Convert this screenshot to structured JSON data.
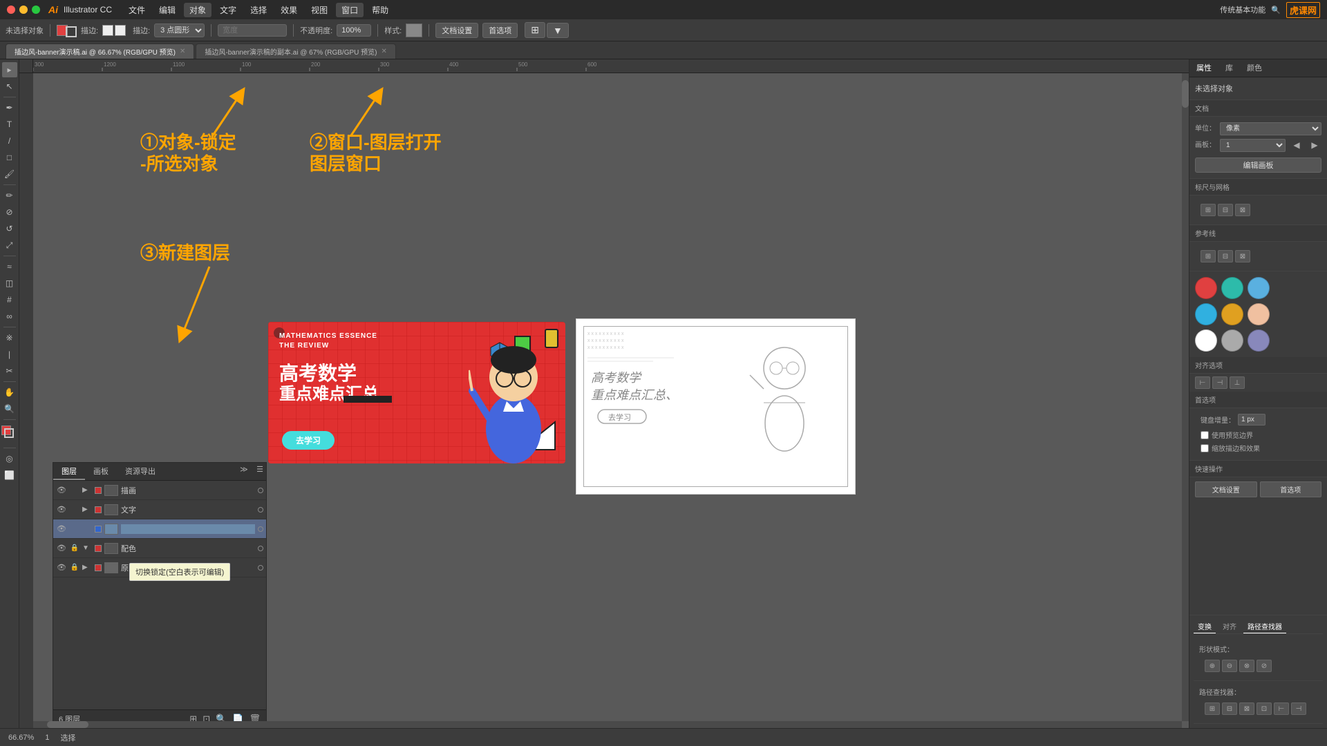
{
  "titlebar": {
    "app_name": "Illustrator CC",
    "traffic": [
      "red",
      "yellow",
      "green"
    ],
    "menus": [
      "文件",
      "编辑",
      "对象",
      "文字",
      "选择",
      "效果",
      "视图",
      "窗口",
      "帮助"
    ],
    "right_label": "传统基本功能",
    "logo": "虎课网"
  },
  "toolbar": {
    "no_select": "未选择对象",
    "stroke_label": "描边:",
    "opacity_label": "不透明度:",
    "opacity_value": "100%",
    "style_label": "样式:",
    "doc_settings": "文档设置",
    "preferences": "首选项",
    "shape_select": "3 点圆形"
  },
  "tabs": [
    {
      "name": "插边风-banner演示稿.ai @ 66.67% (RGB/GPU 预览)",
      "active": true
    },
    {
      "name": "插边风-banner演示稿的副本.ai @ 67% (RGB/GPU 预览)",
      "active": false
    }
  ],
  "annotations": {
    "arrow1_label": "①对象-锁定\n-所选对象",
    "arrow2_label": "②窗口-图层打开\n图层窗口",
    "arrow3_label": "③新建图层"
  },
  "banner": {
    "en_line1": "MATHEMATICS ESSENCE",
    "en_line2": "THE REVIEW",
    "title_cn": "高考数学",
    "subtitle_cn": "重点难点汇总",
    "btn_label": "去学习"
  },
  "layer_panel": {
    "tabs": [
      "图层",
      "画板",
      "资源导出"
    ],
    "layers": [
      {
        "name": "描画",
        "visible": true,
        "locked": false,
        "color": "#aa3333"
      },
      {
        "name": "文字",
        "visible": true,
        "locked": false,
        "color": "#aa3333"
      },
      {
        "name": "",
        "visible": true,
        "locked": false,
        "color": "#3366aa",
        "editing": true
      },
      {
        "name": "配色",
        "visible": true,
        "locked": true,
        "color": "#aa3333",
        "expanded": true
      },
      {
        "name": "原图",
        "visible": true,
        "locked": true,
        "color": "#aa3333"
      }
    ],
    "layer_count": "6 图层",
    "tooltip": "切换锁定(空白表示可编辑)"
  },
  "right_panel": {
    "tabs": [
      "属性",
      "库",
      "颜色"
    ],
    "no_select": "未选择对象",
    "doc_section": "文档",
    "unit_label": "单位：",
    "unit_value": "像素",
    "artboard_label": "画板：",
    "artboard_value": "1",
    "edit_artboard_btn": "编辑画板",
    "grid_label": "标尺与网格",
    "guides_label": "参考线",
    "align_label": "对齐选项",
    "preferences_label": "首选项",
    "kbd_label": "键盘增量：",
    "kbd_value": "1 px",
    "use_preview": "使用预览边界",
    "scale_stroke": "缩放描边和效果",
    "quick_actions": {
      "label": "快速操作",
      "doc_settings": "文档设置",
      "preferences": "首选项"
    },
    "swatches": [
      {
        "color": "#e04040",
        "name": "red"
      },
      {
        "color": "#2dbbaa",
        "name": "teal"
      },
      {
        "color": "#5ab0e0",
        "name": "light-blue"
      },
      {
        "color": "#30b0e0",
        "name": "cyan"
      },
      {
        "color": "#e0a020",
        "name": "orange"
      },
      {
        "color": "#f0c0a0",
        "name": "peach"
      },
      {
        "color": "#ffffff",
        "name": "white"
      },
      {
        "color": "#aaaaaa",
        "name": "gray"
      },
      {
        "color": "#8888bb",
        "name": "lavender"
      }
    ],
    "bottom_tabs": [
      "变换",
      "对齐",
      "路径查找器"
    ],
    "shape_modes_label": "形状模式：",
    "path_finders_label": "路径查找器："
  },
  "statusbar": {
    "zoom": "66.67%",
    "artboard": "1",
    "tool": "选择"
  }
}
